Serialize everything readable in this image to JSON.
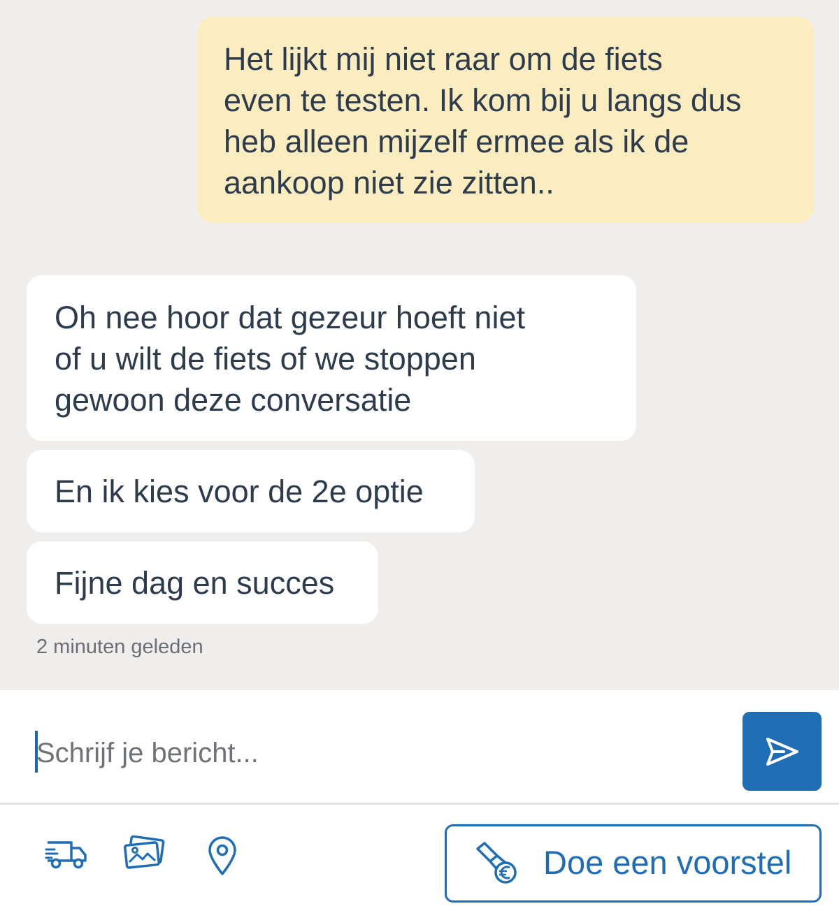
{
  "messages": [
    {
      "direction": "outgoing",
      "text": "Het lijkt mij niet raar om de fiets\neven te testen. Ik kom bij u langs dus\nheb alleen mijzelf ermee als ik de\naankoop niet zie zitten.."
    },
    {
      "direction": "incoming",
      "text": "Oh nee hoor dat gezeur hoeft niet\nof u wilt de fiets of we stoppen\ngewoon deze conversatie"
    },
    {
      "direction": "incoming",
      "text": "En ik kies voor de 2e optie"
    },
    {
      "direction": "incoming",
      "text": "Fijne dag en succes"
    }
  ],
  "thread": {
    "timestamp": "2 minuten geleden"
  },
  "composer": {
    "value": "",
    "placeholder": "Schrijf je bericht...",
    "send_icon": "send-icon"
  },
  "toolbar": {
    "icons": [
      "truck-icon",
      "photos-icon",
      "location-pin-icon"
    ],
    "offer_label": "Doe een voorstel",
    "offer_icon": "offer-hand-euro-icon"
  },
  "colors": {
    "thread_background": "#efeeec",
    "outgoing_bubble": "#fcedc0",
    "incoming_bubble": "#ffffff",
    "message_text": "#2d3c4d",
    "accent": "#1f6db5"
  }
}
